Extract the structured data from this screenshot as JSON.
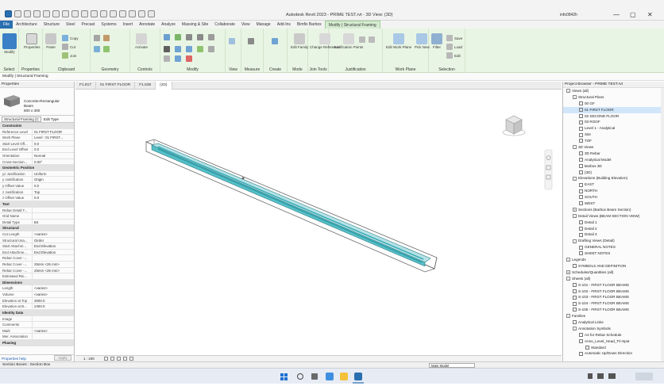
{
  "window": {
    "title": "Autodesk Revit 2023 - PRIME TEST.rvt - 3D View: {3D}",
    "user": "info0842h",
    "minimize": "—",
    "maximize": "▢",
    "close": "✕"
  },
  "tabs": [
    {
      "label": "File",
      "kind": "file"
    },
    {
      "label": "Architecture"
    },
    {
      "label": "Structure"
    },
    {
      "label": "Steel"
    },
    {
      "label": "Precast"
    },
    {
      "label": "Systems"
    },
    {
      "label": "Insert"
    },
    {
      "label": "Annotate"
    },
    {
      "label": "Analyze"
    },
    {
      "label": "Massing & Site"
    },
    {
      "label": "Collaborate"
    },
    {
      "label": "View"
    },
    {
      "label": "Manage"
    },
    {
      "label": "Add-Ins"
    },
    {
      "label": "Bimfix Barbox"
    },
    {
      "label": "Modify | Structural Framing",
      "kind": "active"
    }
  ],
  "ribbon": {
    "select": {
      "label": "Select",
      "modify": "Modify"
    },
    "properties": {
      "label": "Properties",
      "btn": "Properties"
    },
    "clipboard": {
      "label": "Clipboard",
      "paste": "Paste",
      "copy": "Copy",
      "cut": "Cut",
      "join": "Join"
    },
    "geometry": {
      "label": "Geometry"
    },
    "controls": {
      "label": "Controls",
      "activate": "Activate"
    },
    "modify": {
      "label": "Modify"
    },
    "view": {
      "label": "View"
    },
    "measure": {
      "label": "Measure"
    },
    "create": {
      "label": "Create"
    },
    "mode": {
      "label": "Mode",
      "edit_family": "Edit Family"
    },
    "join_tools": {
      "label": "Join Tools",
      "change_ref": "Change Reference"
    },
    "justification": {
      "label": "Justification",
      "points": "Justification Points"
    },
    "work_plane": {
      "label": "Work Plane",
      "edit": "Edit Work Plane",
      "pick_new": "Pick New"
    },
    "selection": {
      "label": "Selection",
      "filter": "Filter",
      "save": "Save",
      "load": "Load",
      "edit": "Edit"
    }
  },
  "context_title": "Modify | Structural Framing",
  "properties": {
    "header": "Properties",
    "type_name_1": "Concrete-Rectangular",
    "type_name_2": "Beam",
    "type_name_3": "600 x 300",
    "selector": "Structural Framing (C",
    "edit_type": "Edit Type",
    "rows": [
      {
        "k": "Constraints",
        "group": true
      },
      {
        "k": "Reference Level",
        "v": "01 FIRST FLOOR"
      },
      {
        "k": "Work Plane",
        "v": "Level : 01 FIRST..."
      },
      {
        "k": "Start Level Off...",
        "v": "0.0"
      },
      {
        "k": "End Level Offset",
        "v": "0.0"
      },
      {
        "k": "Orientation",
        "v": "Normal"
      },
      {
        "k": "Cross-Section...",
        "v": "0.00°"
      },
      {
        "k": "Geometric Position",
        "group": true
      },
      {
        "k": "yz Justification",
        "v": "Uniform"
      },
      {
        "k": "y Justification",
        "v": "Origin"
      },
      {
        "k": "y Offset Value",
        "v": "0.0"
      },
      {
        "k": "z Justification",
        "v": "Top"
      },
      {
        "k": "z Offset Value",
        "v": "0.0"
      },
      {
        "k": "Text",
        "group": true
      },
      {
        "k": "Rebar Detail T...",
        "v": ""
      },
      {
        "k": "Grid Name",
        "v": ""
      },
      {
        "k": "Detail Type",
        "v": "B4"
      },
      {
        "k": "Structural",
        "group": true
      },
      {
        "k": "Cut Length",
        "v": "<varies>"
      },
      {
        "k": "Structural Usa...",
        "v": "Girder"
      },
      {
        "k": "Start Attachm...",
        "v": "End Elevation"
      },
      {
        "k": "End Attachme...",
        "v": "End Elevation"
      },
      {
        "k": "Rebar Cover -...",
        "v": ""
      },
      {
        "k": "Rebar Cover -...",
        "v": "25mm <25 mm>"
      },
      {
        "k": "Rebar Cover -...",
        "v": "25mm <25 mm>"
      },
      {
        "k": "Estimated Rei...",
        "v": ""
      },
      {
        "k": "Dimensions",
        "group": true
      },
      {
        "k": "Length",
        "v": "<varies>"
      },
      {
        "k": "Volume",
        "v": "<varies>"
      },
      {
        "k": "Elevation at Top",
        "v": "3000.0"
      },
      {
        "k": "Elevation at B...",
        "v": "2400.0"
      },
      {
        "k": "Identity Data",
        "group": true
      },
      {
        "k": "Image",
        "v": ""
      },
      {
        "k": "Comments",
        "v": ""
      },
      {
        "k": "Mark",
        "v": "<varies>"
      },
      {
        "k": "Mer. Association",
        "v": ""
      },
      {
        "k": "Phasing",
        "group": true
      }
    ],
    "help_link": "Properties help",
    "apply": "Apply"
  },
  "view_tabs": [
    {
      "label": "F1.817"
    },
    {
      "label": "01 FIRST FLOOR"
    },
    {
      "label": "F1.836"
    },
    {
      "label": "{3D}",
      "active": true
    }
  ],
  "view_control": {
    "scale": "1 : 100"
  },
  "browser": {
    "header": "Project Browser - PRIME TEST.rvt",
    "nodes": [
      {
        "t": "Views (all)",
        "lvl": 0,
        "tg": "-"
      },
      {
        "t": "Structural Plans",
        "lvl": 1,
        "tg": "-"
      },
      {
        "t": "00 GF",
        "lvl": 2
      },
      {
        "t": "01 FIRST FLOOR",
        "lvl": 2,
        "sel": true
      },
      {
        "t": "02 SECOND FLOOR",
        "lvl": 2
      },
      {
        "t": "03 ROOF",
        "lvl": 2
      },
      {
        "t": "Level 1 - Analytical",
        "lvl": 2
      },
      {
        "t": "Site",
        "lvl": 2
      },
      {
        "t": "TOF",
        "lvl": 2
      },
      {
        "t": "3D Views",
        "lvl": 1,
        "tg": "-"
      },
      {
        "t": "3D Rebar",
        "lvl": 2
      },
      {
        "t": "Analytical Model",
        "lvl": 2
      },
      {
        "t": "Barbox 3D",
        "lvl": 2
      },
      {
        "t": "{3D}",
        "lvl": 2
      },
      {
        "t": "Elevations (Building Elevation)",
        "lvl": 1,
        "tg": "-"
      },
      {
        "t": "EAST",
        "lvl": 2
      },
      {
        "t": "NORTH",
        "lvl": 2
      },
      {
        "t": "SOUTH",
        "lvl": 2
      },
      {
        "t": "WEST",
        "lvl": 2
      },
      {
        "t": "Sections (Barbox Beam Section)",
        "lvl": 1,
        "tg": "+"
      },
      {
        "t": "Detail Views (BEAM SECTION VIEW)",
        "lvl": 1,
        "tg": "-"
      },
      {
        "t": "Detail 1",
        "lvl": 2
      },
      {
        "t": "Detail 2",
        "lvl": 2
      },
      {
        "t": "Detail 3",
        "lvl": 2
      },
      {
        "t": "Drafting Views (Detail)",
        "lvl": 1,
        "tg": "-"
      },
      {
        "t": "GENERAL NOTES",
        "lvl": 2
      },
      {
        "t": "SHEET NOTES",
        "lvl": 2
      },
      {
        "t": "Legends",
        "lvl": 0,
        "tg": "-"
      },
      {
        "t": "SYMBOLS AND DEFINITION",
        "lvl": 1
      },
      {
        "t": "Schedules/Quantities (all)",
        "lvl": 0,
        "tg": "+"
      },
      {
        "t": "Sheets (all)",
        "lvl": 0,
        "tg": "-"
      },
      {
        "t": "S-101 - FIRST FLOOR BEAMS",
        "lvl": 1
      },
      {
        "t": "S-102 - FIRST FLOOR BEAMS",
        "lvl": 1
      },
      {
        "t": "S-103 - FIRST FLOOR BEAMS",
        "lvl": 1
      },
      {
        "t": "S-104 - FIRST FLOOR BEAMS",
        "lvl": 1
      },
      {
        "t": "S-105 - FIRST FLOOR BEAMS",
        "lvl": 1
      },
      {
        "t": "Families",
        "lvl": 0,
        "tg": "-"
      },
      {
        "t": "Analytical Links",
        "lvl": 1
      },
      {
        "t": "Annotation Symbols",
        "lvl": 1,
        "tg": "-"
      },
      {
        "t": "A4 for Rebar Schedule",
        "lvl": 2
      },
      {
        "t": "Anno_Level_Head_Tri-Spot",
        "lvl": 2
      },
      {
        "t": "Standard",
        "lvl": 3
      },
      {
        "t": "Automatic Up/Down Direction",
        "lvl": 2
      }
    ]
  },
  "status": {
    "left": "Section Boxes : Section Box",
    "model": "Main Model"
  },
  "colors": {
    "accent": "#2a6fb0",
    "ribbon": "#e9f5e4",
    "beam": "#2fa8b5"
  }
}
